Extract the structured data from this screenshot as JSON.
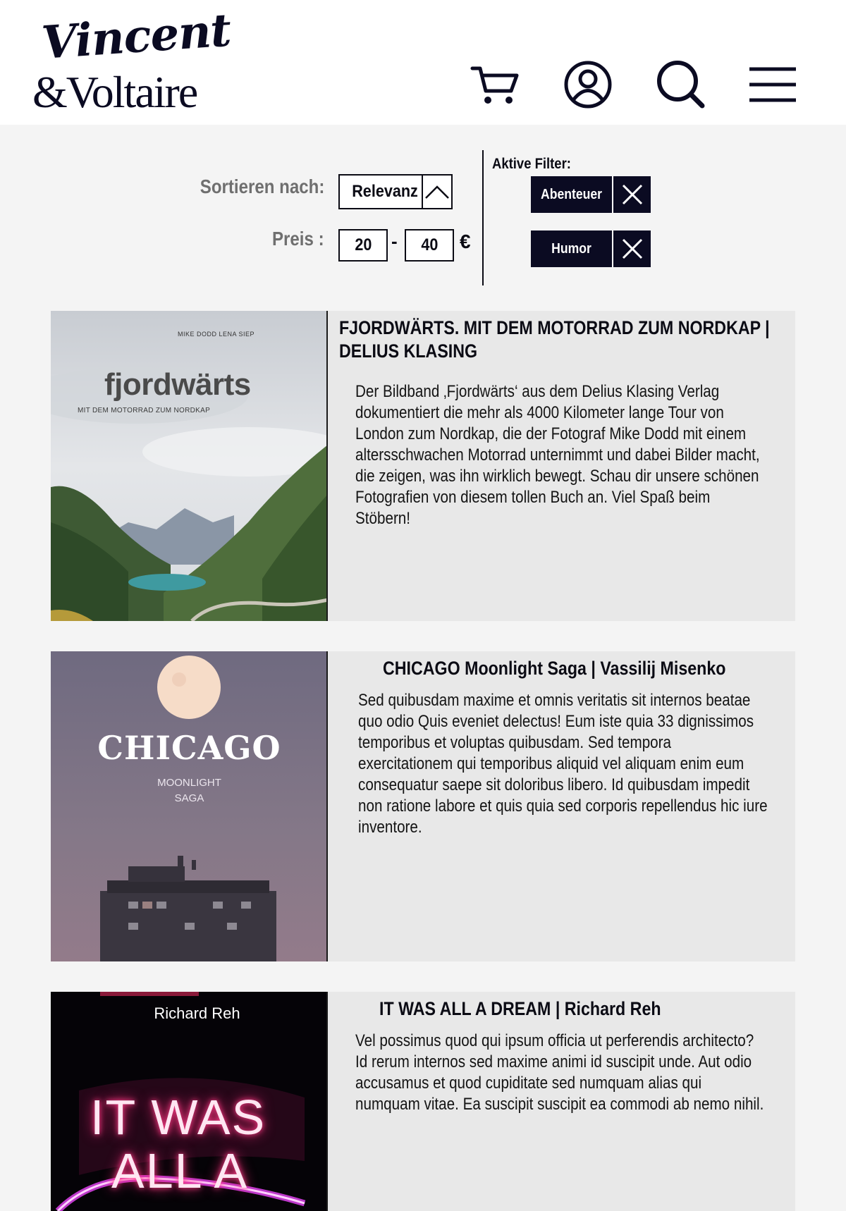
{
  "header": {
    "logo": {
      "line1": "Vincent",
      "line2": "&Voltaire"
    },
    "icons": [
      "cart-icon",
      "account-icon",
      "search-icon",
      "menu-icon"
    ]
  },
  "filters": {
    "sort_label": "Sortieren nach:",
    "sort_value": "Relevanz",
    "price_label": "Preis :",
    "price_min": "20",
    "price_separator": "-",
    "price_max": "40",
    "currency": "€",
    "active_label": "Aktive Filter:",
    "active": [
      {
        "label": "Abenteuer"
      },
      {
        "label": "Humor"
      }
    ]
  },
  "books": [
    {
      "title_line1": "FJORDWÄRTS. MIT DEM MOTORRAD ZUM NORDKAP |",
      "title_line2": "DELIUS KLASING",
      "description": "Der Bildband ‚Fjordwärts‘ aus dem Delius Klasing Verlag dokumentiert die mehr als 4000 Kilometer lange Tour von London zum Nordkap, die der Fotograf Mike Dodd mit einem altersschwachen Motorrad unternimmt und dabei Bilder macht, die zeigen, was ihn wirklich bewegt. Schau dir unsere schönen Fotografien von diesem tollen Buch an. Viel Spaß beim Stöbern!",
      "cover": {
        "authors": "MIKE DODD     LENA SIEP",
        "title": "fjordwärts",
        "subtitle": "MIT DEM MOTORRAD ZUM NORDKAP"
      }
    },
    {
      "title_line1": "CHICAGO Moonlight Saga |  Vassilij Misenko",
      "description": "Sed quibusdam maxime et omnis veritatis sit internos beatae quo odio Quis eveniet delectus! Eum iste quia 33 dignissimos temporibus et voluptas quibusdam. Sed tempora exercitationem qui temporibus aliquid vel aliquam enim eum consequatur saepe sit doloribus libero. Id quibusdam impedit non ratione labore et quis quia sed corporis repellendus hic iure inventore.",
      "cover": {
        "title": "CHICAGO",
        "subtitle1": "MOONLIGHT",
        "subtitle2": "SAGA"
      }
    },
    {
      "title_line1": "IT WAS ALL A DREAM | Richard Reh",
      "description": "Vel possimus quod qui ipsum officia ut perferendis architecto? Id rerum internos sed maxime animi id suscipit unde. Aut odio accusamus et quod cupiditate sed numquam alias qui numquam vitae. Ea suscipit suscipit ea commodi ab nemo nihil.",
      "cover": {
        "author": "Richard Reh",
        "line1": "IT WAS",
        "line2": "ALL A"
      }
    }
  ],
  "colors": {
    "navy": "#0b0b22",
    "page_bg": "#f4f4f4",
    "card_bg": "#e8e8e8",
    "label_gray": "#6f6f6f"
  }
}
